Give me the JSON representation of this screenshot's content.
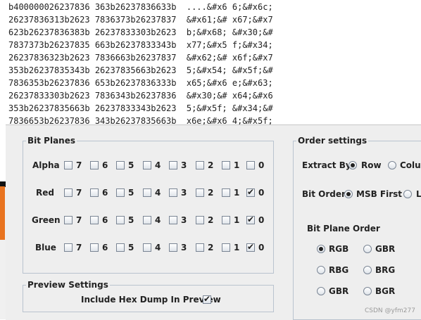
{
  "hex_dump": {
    "lines": [
      "b400000026237836 363b26237836633b  ....&#x6 6;&#x6c;",
      "26237836313b2623 7836373b26237837  &#x61;&# x67;&#x7",
      "623b26237836383b 26237833303b2623  b;&#x68; &#x30;&#",
      "7837373b26237835 663b26237833343b  x77;&#x5 f;&#x34;",
      "26237836323b2623 7836663b26237837  &#x62;&# x6f;&#x7",
      "353b26237835343b 26237835663b2623  5;&#x54; &#x5f;&#",
      "7836353b26237836 653b26237836333b  x65;&#x6 e;&#x63;",
      "26237833303b2623 7836343b26237836  &#x30;&# x64;&#x6",
      "353b26237835663b 26237833343b2623  5;&#x5f; &#x34;&#",
      "7836653b26237836 343b26237835663b  x6e;&#x6 4;&#x5f;"
    ]
  },
  "bit_planes": {
    "title": "Bit Planes",
    "rows": [
      {
        "label": "Alpha",
        "bits": [
          "7",
          "6",
          "5",
          "4",
          "3",
          "2",
          "1",
          "0"
        ],
        "checked": [
          false,
          false,
          false,
          false,
          false,
          false,
          false,
          false
        ]
      },
      {
        "label": "Red",
        "bits": [
          "7",
          "6",
          "5",
          "4",
          "3",
          "2",
          "1",
          "0"
        ],
        "checked": [
          false,
          false,
          false,
          false,
          false,
          false,
          false,
          true
        ]
      },
      {
        "label": "Green",
        "bits": [
          "7",
          "6",
          "5",
          "4",
          "3",
          "2",
          "1",
          "0"
        ],
        "checked": [
          false,
          false,
          false,
          false,
          false,
          false,
          false,
          true
        ]
      },
      {
        "label": "Blue",
        "bits": [
          "7",
          "6",
          "5",
          "4",
          "3",
          "2",
          "1",
          "0"
        ],
        "checked": [
          false,
          false,
          false,
          false,
          false,
          false,
          false,
          true
        ]
      }
    ]
  },
  "preview_settings": {
    "title": "Preview Settings",
    "include_hex_label": "Include Hex Dump In Preview",
    "include_hex_checked": true
  },
  "order_settings": {
    "title": "Order settings",
    "extract_by_label": "Extract By",
    "extract_options": [
      "Row",
      "Colum"
    ],
    "extract_selected": 0,
    "bit_order_label": "Bit Order",
    "bit_order_options": [
      "MSB First",
      "L"
    ],
    "bit_order_selected": 0,
    "plane_order_label": "Bit Plane Order",
    "plane_order_options": [
      "RGB",
      "GBR",
      "RBG",
      "BRG",
      "GBR",
      "BGR"
    ],
    "plane_order_selected": 0
  },
  "watermark": "CSDN @yfm277",
  "colors": {
    "accent_orange": "#e8731f",
    "panel_bg": "#eeeeee",
    "group_border": "#b9c3cf"
  }
}
